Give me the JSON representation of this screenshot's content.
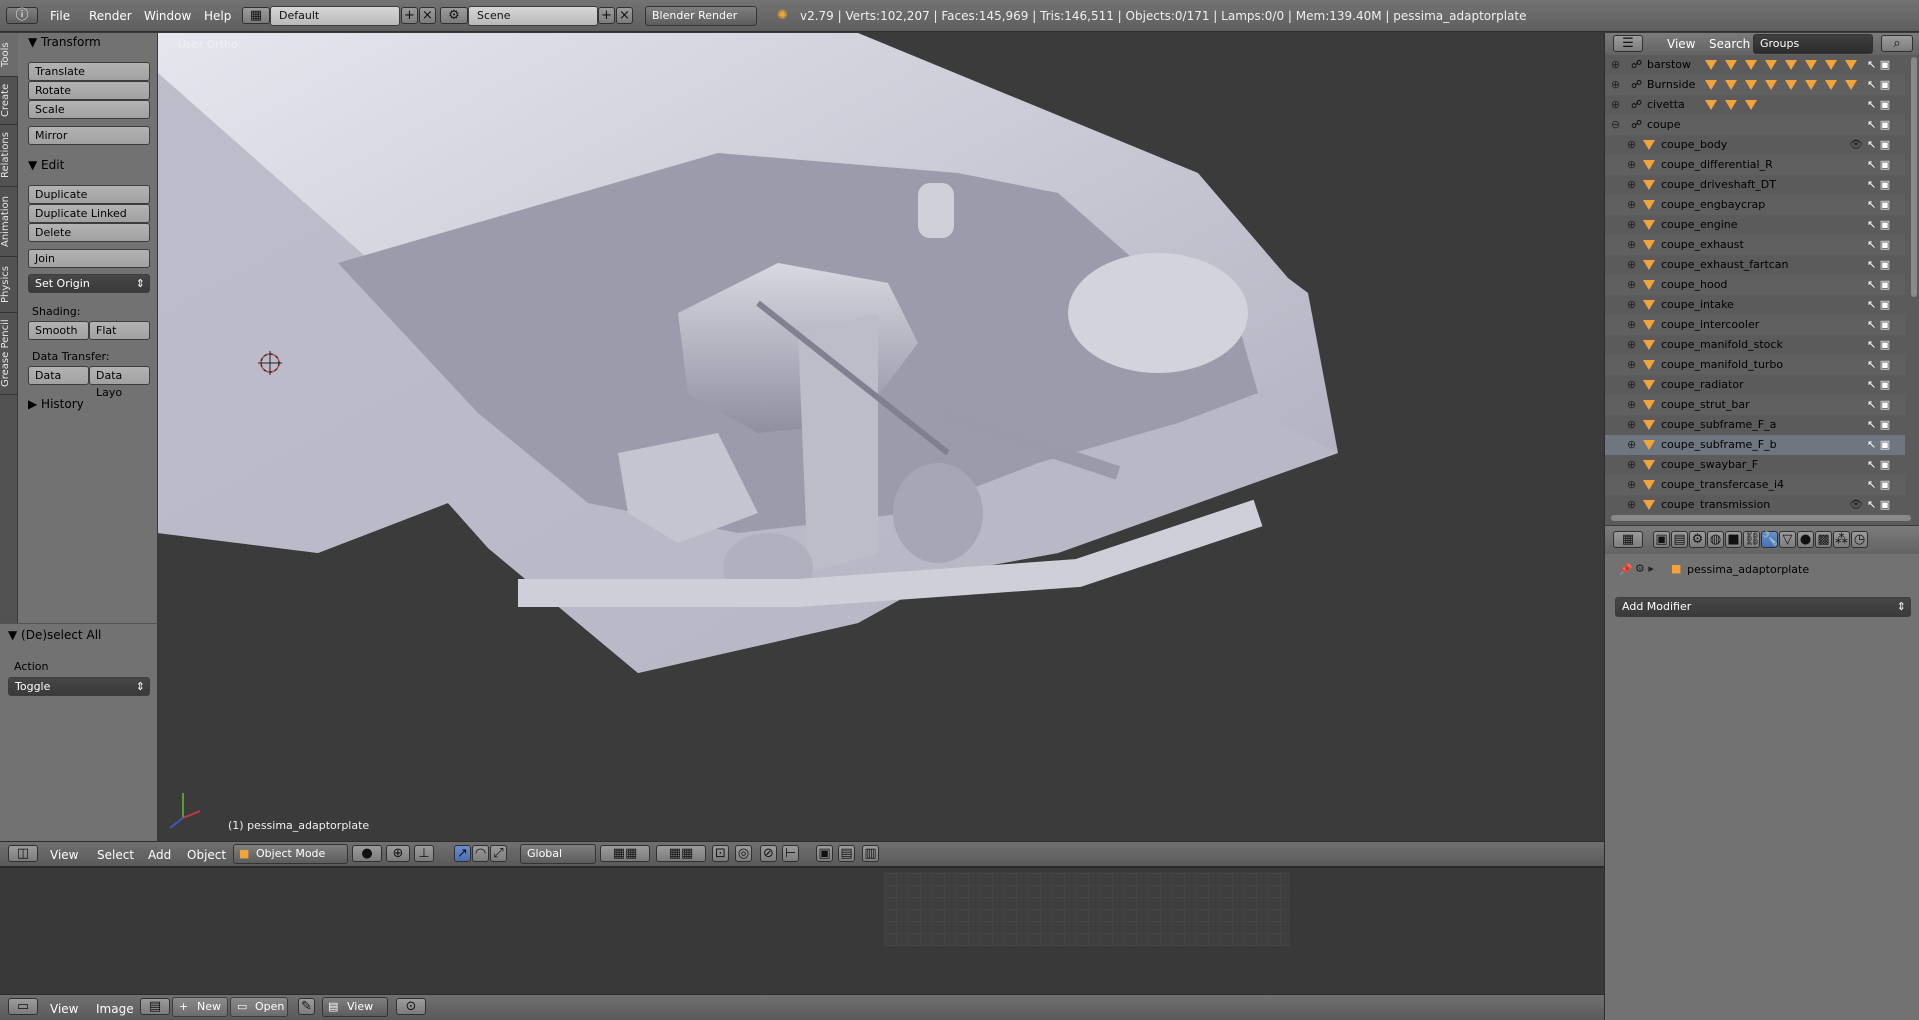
{
  "topbar": {
    "menus": [
      "File",
      "Render",
      "Window",
      "Help"
    ],
    "layout": "Default",
    "scene": "Scene",
    "engine": "Blender Render",
    "stats": "v2.79 | Verts:102,207 | Faces:145,969 | Tris:146,511 | Objects:0/171 | Lamps:0/0 | Mem:139.40M | pessima_adaptorplate"
  },
  "tool_tabs": [
    "Tools",
    "Create",
    "Relations",
    "Animation",
    "Physics",
    "Grease Pencil"
  ],
  "tools": {
    "transform_title": "Transform",
    "translate": "Translate",
    "rotate": "Rotate",
    "scale": "Scale",
    "mirror": "Mirror",
    "edit_title": "Edit",
    "duplicate": "Duplicate",
    "duplicate_linked": "Duplicate Linked",
    "delete": "Delete",
    "join": "Join",
    "set_origin": "Set Origin",
    "shading_label": "Shading:",
    "smooth": "Smooth",
    "flat": "Flat",
    "data_transfer_label": "Data Transfer:",
    "data": "Data",
    "data_layout": "Data Layo",
    "history_title": "History"
  },
  "operator": {
    "title": "(De)select All",
    "action_label": "Action",
    "action_value": "Toggle"
  },
  "viewport": {
    "view_label": "User Ortho",
    "object_label": "(1) pessima_adaptorplate"
  },
  "view3d_header": {
    "menus": [
      "View",
      "Select",
      "Add",
      "Object"
    ],
    "mode": "Object Mode",
    "orientation": "Global"
  },
  "image_header": {
    "menus": [
      "View",
      "Image"
    ],
    "new": "New",
    "open": "Open",
    "view": "View"
  },
  "outliner": {
    "menus": [
      "View",
      "Search"
    ],
    "display": "Groups",
    "groups": [
      {
        "name": "barstow",
        "tris": 8
      },
      {
        "name": "Burnside",
        "tris": 8
      },
      {
        "name": "civetta",
        "tris": 3
      },
      {
        "name": "coupe",
        "tris": 0
      }
    ],
    "children": [
      "coupe_body",
      "coupe_differential_R",
      "coupe_driveshaft_DT",
      "coupe_engbaycrap",
      "coupe_engine",
      "coupe_exhaust",
      "coupe_exhaust_fartcan",
      "coupe_hood",
      "coupe_intake",
      "coupe_intercooler",
      "coupe_manifold_stock",
      "coupe_manifold_turbo",
      "coupe_radiator",
      "coupe_strut_bar",
      "coupe_subframe_F_a",
      "coupe_subframe_F_b",
      "coupe_swaybar_F",
      "coupe_transfercase_i4",
      "coupe_transmission"
    ]
  },
  "properties": {
    "object_name": "pessima_adaptorplate",
    "add_modifier": "Add Modifier"
  },
  "colors": {
    "accent_blue": "#5680c2",
    "group_triangle": "#f2a33a",
    "mesh_color": "#d4d4de"
  }
}
